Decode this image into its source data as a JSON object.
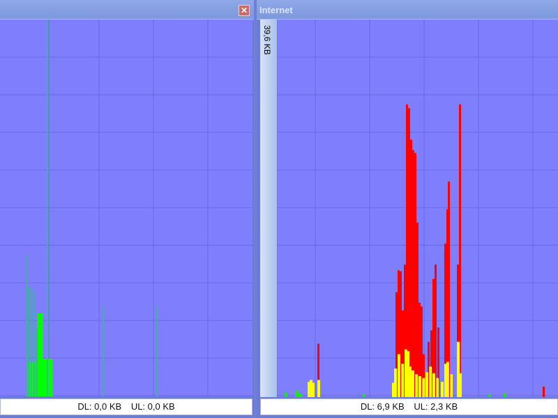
{
  "left_panel": {
    "title": "",
    "close_icon": "close-icon",
    "status": {
      "dl": "DL: 0,0 KB",
      "ul": "UL: 0,0 KB"
    }
  },
  "right_panel": {
    "title": "Internet",
    "scale_label": "39,6 KB",
    "status": {
      "dl": "DL: 6,9 KB",
      "ul": "UL: 2,3 KB"
    }
  },
  "colors": {
    "background": "#7f7ffe",
    "grid": "#6a6ae0",
    "download": "#ff0000",
    "upload": "#ffff00",
    "other": "#20e020",
    "left_line": "#40b0a0",
    "left_fill": "#00ff00"
  },
  "chart_data": [
    {
      "type": "bar",
      "panel": "left",
      "ylim": [
        0,
        100
      ],
      "grid": true,
      "series": [
        {
          "values": [
            [
              37,
              37.5
            ],
            [
              40,
              29
            ],
            [
              44,
              29
            ],
            [
              48,
              28
            ],
            [
              52,
              18
            ],
            [
              67,
              100
            ],
            [
              147,
              24
            ],
            [
              224,
              24
            ]
          ]
        },
        {
          "ranges": [
            [
              37,
              53,
              9
            ],
            [
              53,
              62,
              22
            ],
            [
              62,
              76,
              10
            ]
          ]
        }
      ]
    },
    {
      "type": "bar",
      "panel": "right",
      "ylim": [
        0,
        39.6
      ],
      "grid": true,
      "series": [
        {
          "values": [
            [
              57,
              5.6
            ],
            [
              169,
              11.0
            ],
            [
              172,
              13.3
            ],
            [
              175,
              13.2
            ],
            [
              178,
              9.1
            ],
            [
              181,
              13.9
            ],
            [
              184,
              30.7
            ],
            [
              187,
              30.3
            ],
            [
              190,
              27.0
            ],
            [
              193,
              25.9
            ],
            [
              196,
              25.6
            ],
            [
              199,
              18.3
            ],
            [
              202,
              9.9
            ],
            [
              205,
              9.5
            ],
            [
              208,
              4.5
            ],
            [
              215,
              5.8
            ],
            [
              219,
              7.0
            ],
            [
              222,
              12.4
            ],
            [
              225,
              13.9
            ],
            [
              229,
              7.3
            ],
            [
              239,
              16.1
            ],
            [
              242,
              19.7
            ],
            [
              244,
              22.6
            ],
            [
              257,
              13.9
            ],
            [
              260,
              30.7
            ],
            [
              380,
              1.1
            ]
          ]
        },
        {
          "values": [
            [
              43,
              1.6
            ],
            [
              46,
              1.8
            ],
            [
              49,
              1.5
            ],
            [
              57,
              1.8
            ],
            [
              164,
              1.5
            ],
            [
              167,
              3.0
            ],
            [
              172,
              4.5
            ],
            [
              177,
              3.5
            ],
            [
              182,
              5.0
            ],
            [
              185,
              4.8
            ],
            [
              188,
              3.2
            ],
            [
              192,
              2.8
            ],
            [
              197,
              2.4
            ],
            [
              202,
              2.2
            ],
            [
              207,
              2.0
            ],
            [
              212,
              2.6
            ],
            [
              217,
              3.2
            ],
            [
              222,
              2.5
            ],
            [
              227,
              2.0
            ],
            [
              234,
              1.6
            ],
            [
              239,
              3.5
            ],
            [
              242,
              3.7
            ],
            [
              247,
              2.4
            ],
            [
              257,
              5.8
            ],
            [
              260,
              2.5
            ]
          ]
        },
        {
          "values": [
            [
              10,
              0.5
            ],
            [
              25,
              0.7
            ],
            [
              29,
              0.4
            ],
            [
              32,
              0.3
            ],
            [
              122,
              0.3
            ],
            [
              302,
              0.3
            ],
            [
              324,
              0.4
            ]
          ]
        }
      ]
    }
  ]
}
